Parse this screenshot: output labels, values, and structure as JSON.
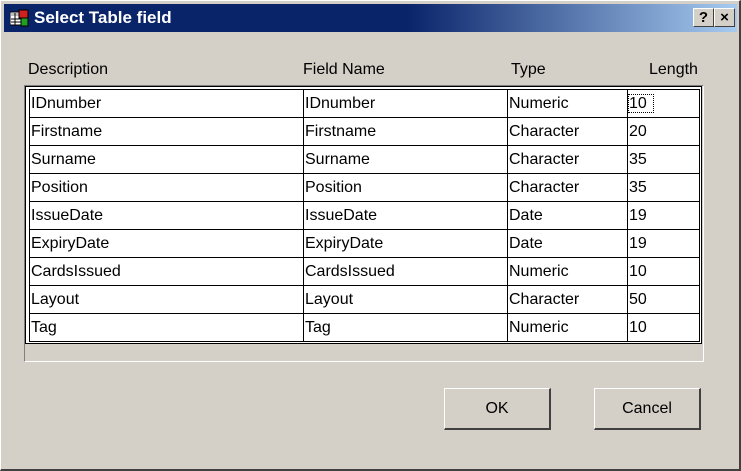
{
  "window": {
    "title": "Select Table field",
    "help_label": "?",
    "close_label": "×"
  },
  "columns": [
    "Description",
    "Field Name",
    "Type",
    "Length"
  ],
  "rows": [
    {
      "description": "IDnumber",
      "field_name": "IDnumber",
      "type": "Numeric",
      "length": "10"
    },
    {
      "description": "Firstname",
      "field_name": "Firstname",
      "type": "Character",
      "length": "20"
    },
    {
      "description": "Surname",
      "field_name": "Surname",
      "type": "Character",
      "length": "35"
    },
    {
      "description": "Position",
      "field_name": "Position",
      "type": "Character",
      "length": "35"
    },
    {
      "description": "IssueDate",
      "field_name": "IssueDate",
      "type": "Date",
      "length": "19"
    },
    {
      "description": "ExpiryDate",
      "field_name": "ExpiryDate",
      "type": "Date",
      "length": "19"
    },
    {
      "description": "CardsIssued",
      "field_name": "CardsIssued",
      "type": "Numeric",
      "length": "10"
    },
    {
      "description": "Layout",
      "field_name": "Layout",
      "type": "Character",
      "length": "50"
    },
    {
      "description": "Tag",
      "field_name": "Tag",
      "type": "Numeric",
      "length": "10"
    }
  ],
  "buttons": {
    "ok_label": "OK",
    "cancel_label": "Cancel"
  },
  "colors": {
    "title_start": "#0a246a",
    "title_end": "#a6caf0",
    "face": "#d4d0c8"
  },
  "icons": {
    "title": "table-window-icon"
  }
}
